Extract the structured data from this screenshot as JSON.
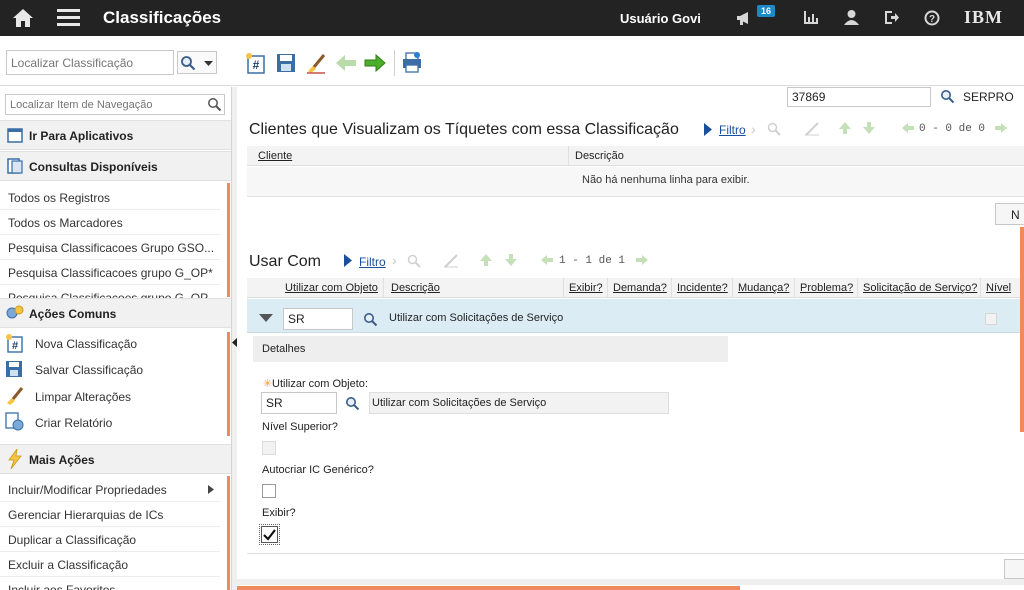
{
  "header": {
    "title": "Classificações",
    "user": "Usuário Govi",
    "notification_count": "16",
    "brand": "IBM"
  },
  "toolbar": {
    "search_placeholder": "Localizar Classificação"
  },
  "sidebar": {
    "nav_search_placeholder": "Localizar Item de Navegação",
    "goto_apps": "Ir Para Aplicativos",
    "queries_title": "Consultas Disponíveis",
    "queries": [
      "Todos os Registros",
      "Todos os Marcadores",
      "Pesquisa Classificacoes Grupo GSO...",
      "Pesquisa Classificacoes grupo G_OP*",
      "Pesquisa Classificacoes grupo G_OP..."
    ],
    "actions_title": "Ações Comuns",
    "actions": [
      "Nova Classificação",
      "Salvar Classificação",
      "Limpar Alterações",
      "Criar Relatório"
    ],
    "more_title": "Mais Ações",
    "more": [
      "Incluir/Modificar Propriedades",
      "Gerenciar Hierarquias de ICs",
      "Duplicar a Classificação",
      "Excluir a Classificação",
      "Incluir aos Favoritos"
    ]
  },
  "main": {
    "top_id": "37869",
    "top_org": "SERPRO",
    "clients": {
      "title": "Clientes que Visualizam os Tíquetes com essa Classificação",
      "filter": "Filtro",
      "paging": "0 - 0 de 0",
      "col_client": "Cliente",
      "col_desc": "Descrição",
      "empty": "Não há nenhuma linha para exibir.",
      "button_partial": "N"
    },
    "usewith": {
      "title": "Usar Com",
      "filter": "Filtro",
      "paging": "1 - 1 de 1",
      "columns": [
        "Utilizar com Objeto",
        "Descrição",
        "Exibir?",
        "Demanda?",
        "Incidente?",
        "Mudança?",
        "Problema?",
        "Solicitação de Serviço?",
        "Nível"
      ],
      "row_object": "SR",
      "row_desc": "Utilizar com Solicitações de Serviço"
    },
    "details": {
      "title": "Detalhes",
      "object_label": "Utilizar com Objeto:",
      "object_value": "SR",
      "object_desc": "Utilizar com Solicitações de Serviço",
      "parent_label": "Nível Superior?",
      "autocreate_label": "Autocriar IC Genérico?",
      "show_label": "Exibir?",
      "show_checked": true
    }
  },
  "colors": {
    "topbar": "#232323",
    "accent_orange": "#f08a5d",
    "link_blue": "#1a4f9c",
    "selected_row": "#dcecf5"
  }
}
